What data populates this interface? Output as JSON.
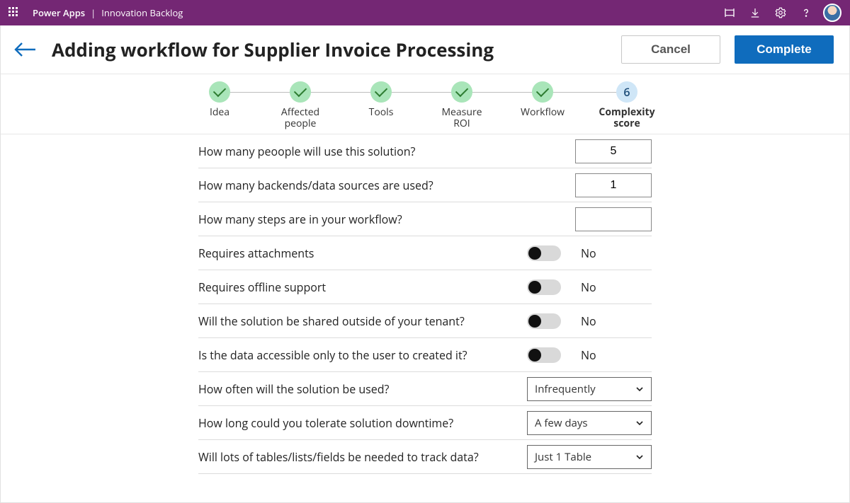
{
  "appbar": {
    "brand": "Power Apps",
    "divider": "|",
    "appTitle": "Innovation Backlog"
  },
  "header": {
    "title": "Adding workflow for Supplier Invoice Processing",
    "cancel": "Cancel",
    "complete": "Complete"
  },
  "stepper": {
    "steps": [
      {
        "label": "Idea",
        "state": "done"
      },
      {
        "label": "Affected\npeople",
        "state": "done"
      },
      {
        "label": "Tools",
        "state": "done"
      },
      {
        "label": "Measure\nROI",
        "state": "done"
      },
      {
        "label": "Workflow",
        "state": "done"
      },
      {
        "label": "Complexity\nscore",
        "state": "current",
        "badge": "6"
      }
    ]
  },
  "questions": {
    "q1": {
      "label": "How many peoople will use this solution?",
      "value": "5"
    },
    "q2": {
      "label": "How many backends/data sources are  used?",
      "value": "1"
    },
    "q3": {
      "label": "How many steps are in your workflow?",
      "value": ""
    },
    "q4": {
      "label": "Requires attachments",
      "toggleLabel": "No"
    },
    "q5": {
      "label": "Requires offline support",
      "toggleLabel": "No"
    },
    "q6": {
      "label": "Will the solution be shared  outside of your tenant?",
      "toggleLabel": "No"
    },
    "q7": {
      "label": "Is the data accessible only to the user to created it?",
      "toggleLabel": "No"
    },
    "q8": {
      "label": "How often will the solution be used?",
      "value": "Infrequently"
    },
    "q9": {
      "label": "How long could you tolerate solution downtime?",
      "value": "A few days"
    },
    "q10": {
      "label": "Will lots of tables/lists/fields be needed to track data?",
      "value": "Just 1 Table"
    }
  }
}
